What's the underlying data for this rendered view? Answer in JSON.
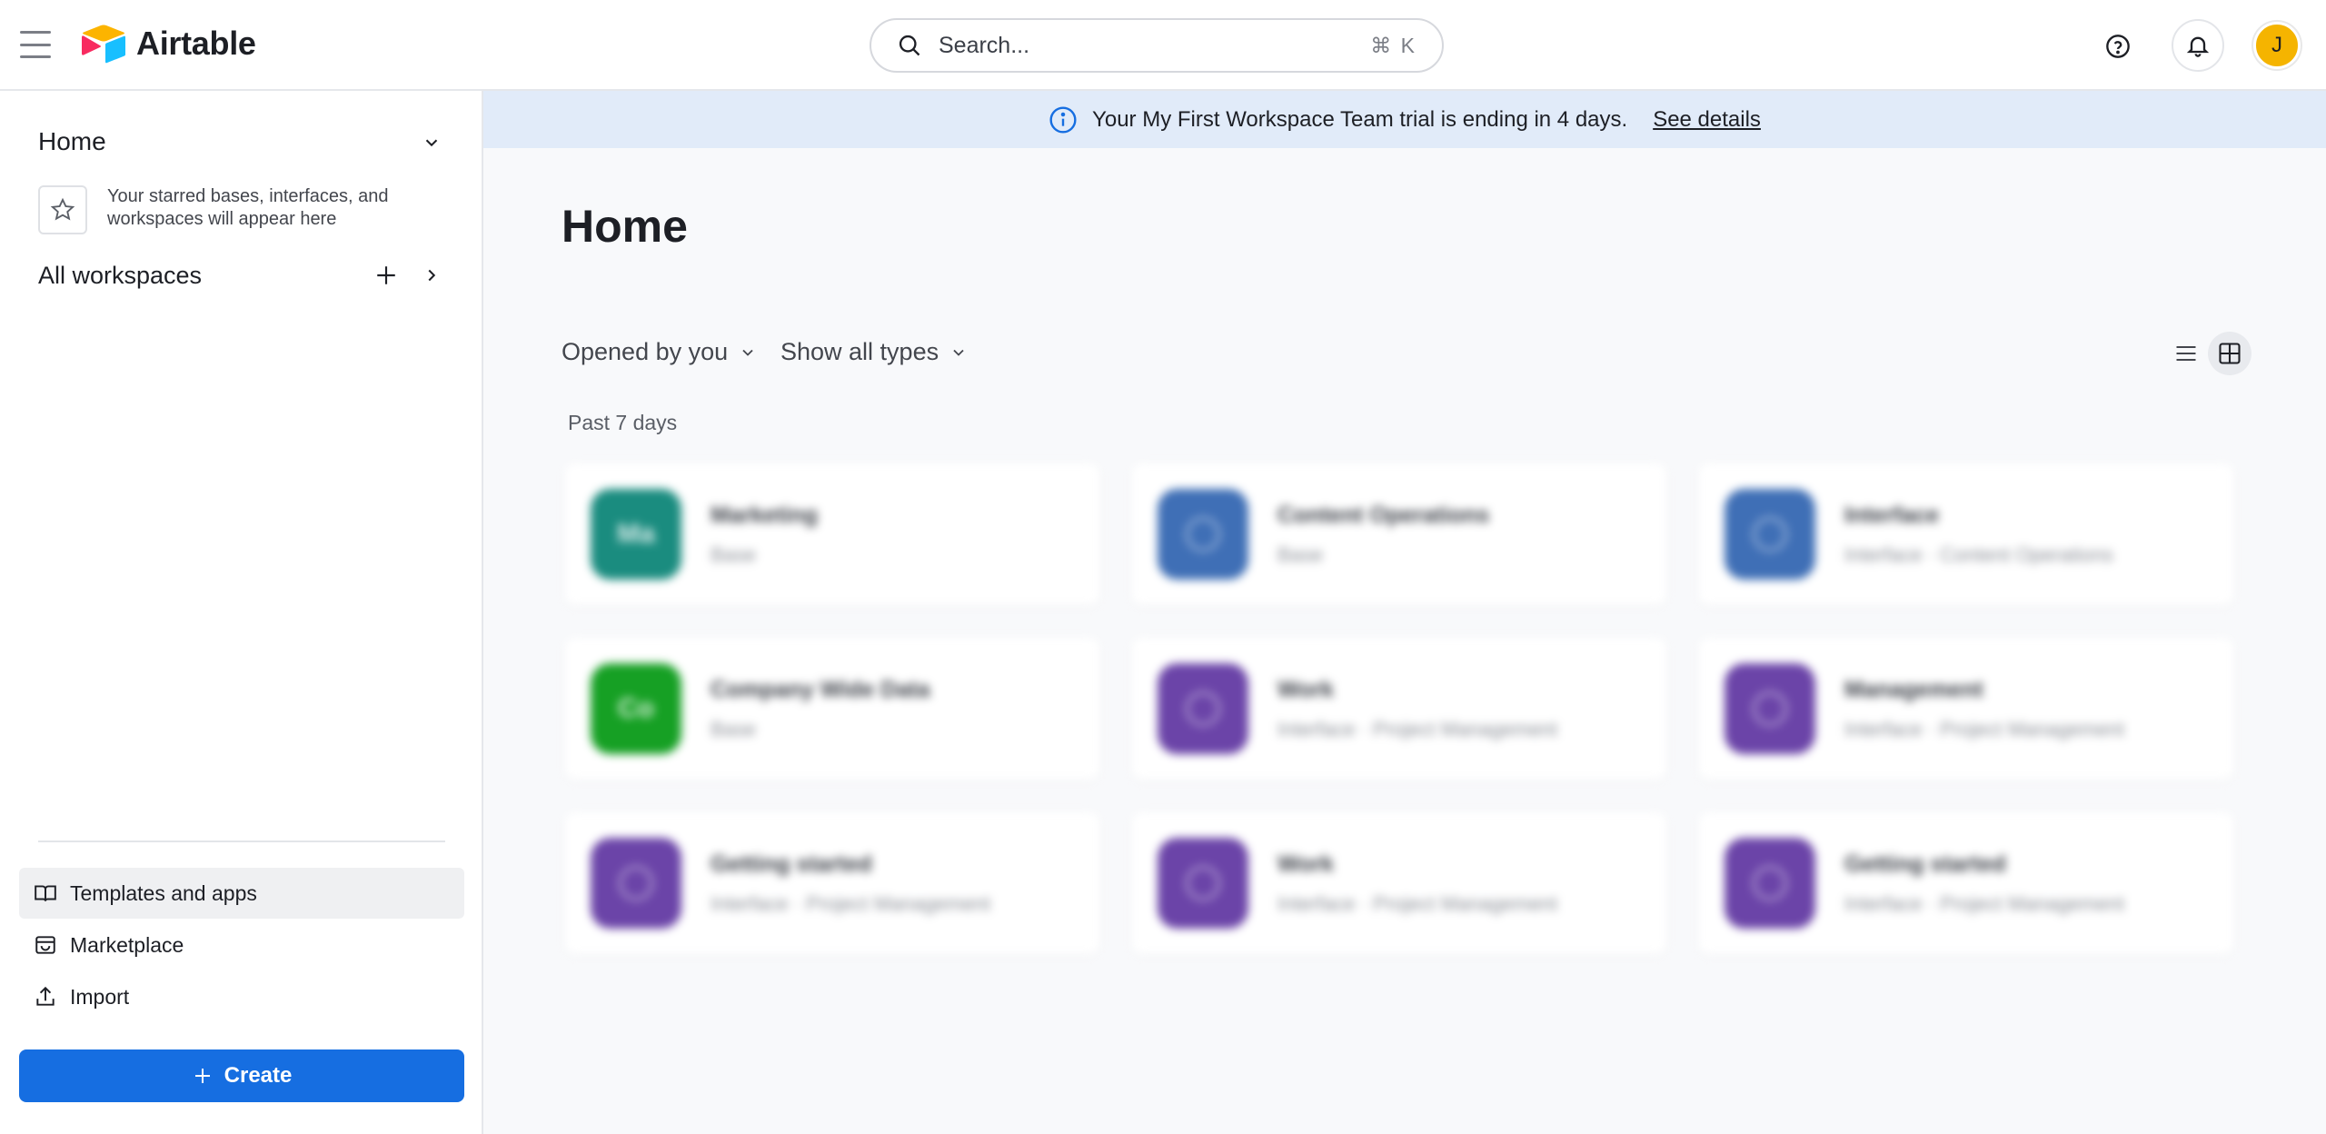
{
  "app": {
    "name": "Airtable",
    "search_placeholder": "Search...",
    "search_shortcut": "⌘ K",
    "user_initial": "J"
  },
  "sidebar": {
    "home_label": "Home",
    "starred_hint": "Your starred bases, interfaces, and workspaces will appear here",
    "all_workspaces_label": "All workspaces",
    "links": [
      {
        "label": "Templates and apps",
        "icon": "book-icon"
      },
      {
        "label": "Marketplace",
        "icon": "marketplace-icon"
      },
      {
        "label": "Import",
        "icon": "upload-icon"
      }
    ],
    "create_label": "Create"
  },
  "banner": {
    "text": "Your My First Workspace Team trial is ending in 4 days.",
    "link": "See details"
  },
  "main": {
    "title": "Home",
    "filter_opened": "Opened by you",
    "filter_types": "Show all types",
    "section_label": "Past 7 days",
    "cards": [
      {
        "name": "Marketing",
        "sub": "Base",
        "abbr": "Ma",
        "color": "#1a8c7f"
      },
      {
        "name": "Content Operations",
        "sub": "Base",
        "abbr": "",
        "color": "#3f6fb6"
      },
      {
        "name": "Interface",
        "sub": "Interface · Content Operations",
        "abbr": "",
        "color": "#3f6fb6"
      },
      {
        "name": "Company Wide Data",
        "sub": "Base",
        "abbr": "Co",
        "color": "#16a024"
      },
      {
        "name": "Work",
        "sub": "Interface · Project Management",
        "abbr": "",
        "color": "#6b44a8"
      },
      {
        "name": "Management",
        "sub": "Interface · Project Management",
        "abbr": "",
        "color": "#6b44a8"
      },
      {
        "name": "Getting started",
        "sub": "Interface · Project Management",
        "abbr": "",
        "color": "#6b44a8"
      },
      {
        "name": "Work",
        "sub": "Interface · Project Management",
        "abbr": "",
        "color": "#6b44a8"
      },
      {
        "name": "Getting started",
        "sub": "Interface · Project Management",
        "abbr": "",
        "color": "#6b44a8"
      }
    ]
  },
  "colors": {
    "accent": "#166ee1",
    "banner_bg": "#e1ebf9",
    "avatar": "#f5b400"
  }
}
